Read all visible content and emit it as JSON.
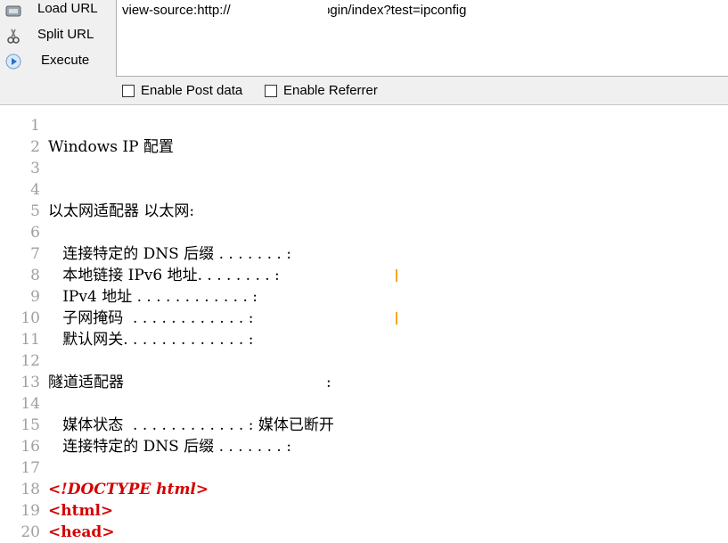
{
  "toolbar": {
    "load_url": "Load URL",
    "split_url": "Split URL",
    "execute": "Execute",
    "url_value": "view-source:http://                       /login/index?test=ipconfig",
    "enable_post": "Enable Post data",
    "enable_referrer": "Enable Referrer"
  },
  "source_lines": [
    {
      "n": "1",
      "text": ""
    },
    {
      "n": "2",
      "text": "Windows IP 配置"
    },
    {
      "n": "3",
      "text": ""
    },
    {
      "n": "4",
      "text": ""
    },
    {
      "n": "5",
      "text": "以太网适配器 以太网:"
    },
    {
      "n": "6",
      "text": ""
    },
    {
      "n": "7",
      "text": "   连接特定的 DNS 后缀 . . . . . . . :"
    },
    {
      "n": "8",
      "text": "   本地链接 IPv6 地址. . . . . . . . :"
    },
    {
      "n": "9",
      "text": "   IPv4 地址 . . . . . . . . . . . . :"
    },
    {
      "n": "10",
      "text": "   子网掩码  . . . . . . . . . . . . :"
    },
    {
      "n": "11",
      "text": "   默认网关. . . . . . . . . . . . . :"
    },
    {
      "n": "12",
      "text": ""
    },
    {
      "n": "13",
      "text": "隧道适配器                                          :"
    },
    {
      "n": "14",
      "text": ""
    },
    {
      "n": "15",
      "text": "   媒体状态  . . . . . . . . . . . . : 媒体已断开"
    },
    {
      "n": "16",
      "text": "   连接特定的 DNS 后缀 . . . . . . . :"
    },
    {
      "n": "17",
      "text": ""
    },
    {
      "n": "18",
      "text": "<!DOCTYPE html>"
    },
    {
      "n": "19",
      "text": "<html>"
    },
    {
      "n": "20",
      "text": "<head>"
    }
  ],
  "colors": {
    "toolbar_bg": "#f0f0f0",
    "line_number": "#a0a0a0",
    "tag_red": "#d40000",
    "redaction_mark_orange": "#f5a623"
  }
}
